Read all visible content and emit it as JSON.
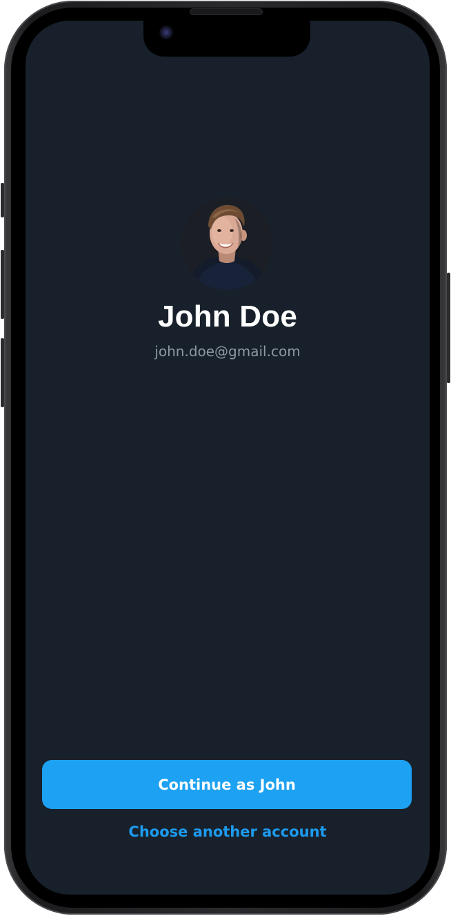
{
  "profile": {
    "name": "John Doe",
    "email": "john.doe@gmail.com",
    "avatar_icon": "user-photo"
  },
  "actions": {
    "continue_label": "Continue as John",
    "choose_account_label": "Choose another account"
  },
  "colors": {
    "screen_background": "#18212b",
    "accent": "#1da1f2",
    "link": "#1d9bf0",
    "secondary_text": "#8c98a4"
  }
}
